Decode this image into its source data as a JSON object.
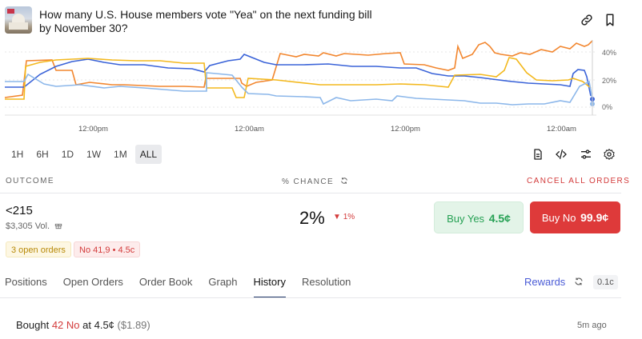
{
  "market": {
    "question": "How many U.S. House members vote \"Yea\" on the next funding bill by November 30?",
    "image_icon": "capitol-building-image"
  },
  "header_actions": [
    {
      "name": "link-icon"
    },
    {
      "name": "bookmark-icon"
    }
  ],
  "chart": {
    "y_ticks": [
      "40%",
      "20%",
      "0%"
    ],
    "x_ticks": [
      "12:00pm",
      "12:00am",
      "12:00pm",
      "12:00am"
    ],
    "colors": {
      "orange": "#f2862e",
      "blue": "#3a63d8",
      "yellow": "#f3b81d",
      "lightblue": "#8cb7ea"
    }
  },
  "time_ranges": [
    "1H",
    "6H",
    "1D",
    "1W",
    "1M",
    "ALL"
  ],
  "active_range": "ALL",
  "tools": [
    "document-icon",
    "embed-code-icon",
    "sliders-icon",
    "settings-icon"
  ],
  "table_header": {
    "outcome": "OUTCOME",
    "chance": "% CHANCE",
    "cancel_all": "CANCEL ALL ORDERS"
  },
  "outcome": {
    "name": "<215",
    "volume": "$3,305 Vol.",
    "chance": "2%",
    "change": "1%",
    "change_direction": "down"
  },
  "buy_yes": {
    "label": "Buy Yes",
    "price": "4.5¢"
  },
  "buy_no": {
    "label": "Buy No",
    "price": "99.9¢"
  },
  "badges": {
    "open_orders": "3 open orders",
    "position": "No 41,9 • 4.5c"
  },
  "tabs": [
    "Positions",
    "Open Orders",
    "Order Book",
    "Graph",
    "History",
    "Resolution"
  ],
  "active_tab": "History",
  "rewards": {
    "label": "Rewards",
    "tick": "0.1c"
  },
  "history": [
    {
      "action": "Bought",
      "qty": "42 No",
      "price": "at 4.5¢",
      "cost": "($1.89)",
      "time": "5m ago"
    }
  ],
  "colors": {
    "yes_green": "#27a155",
    "no_red": "#de3a3a",
    "accent_blue": "#4a5bd6"
  }
}
